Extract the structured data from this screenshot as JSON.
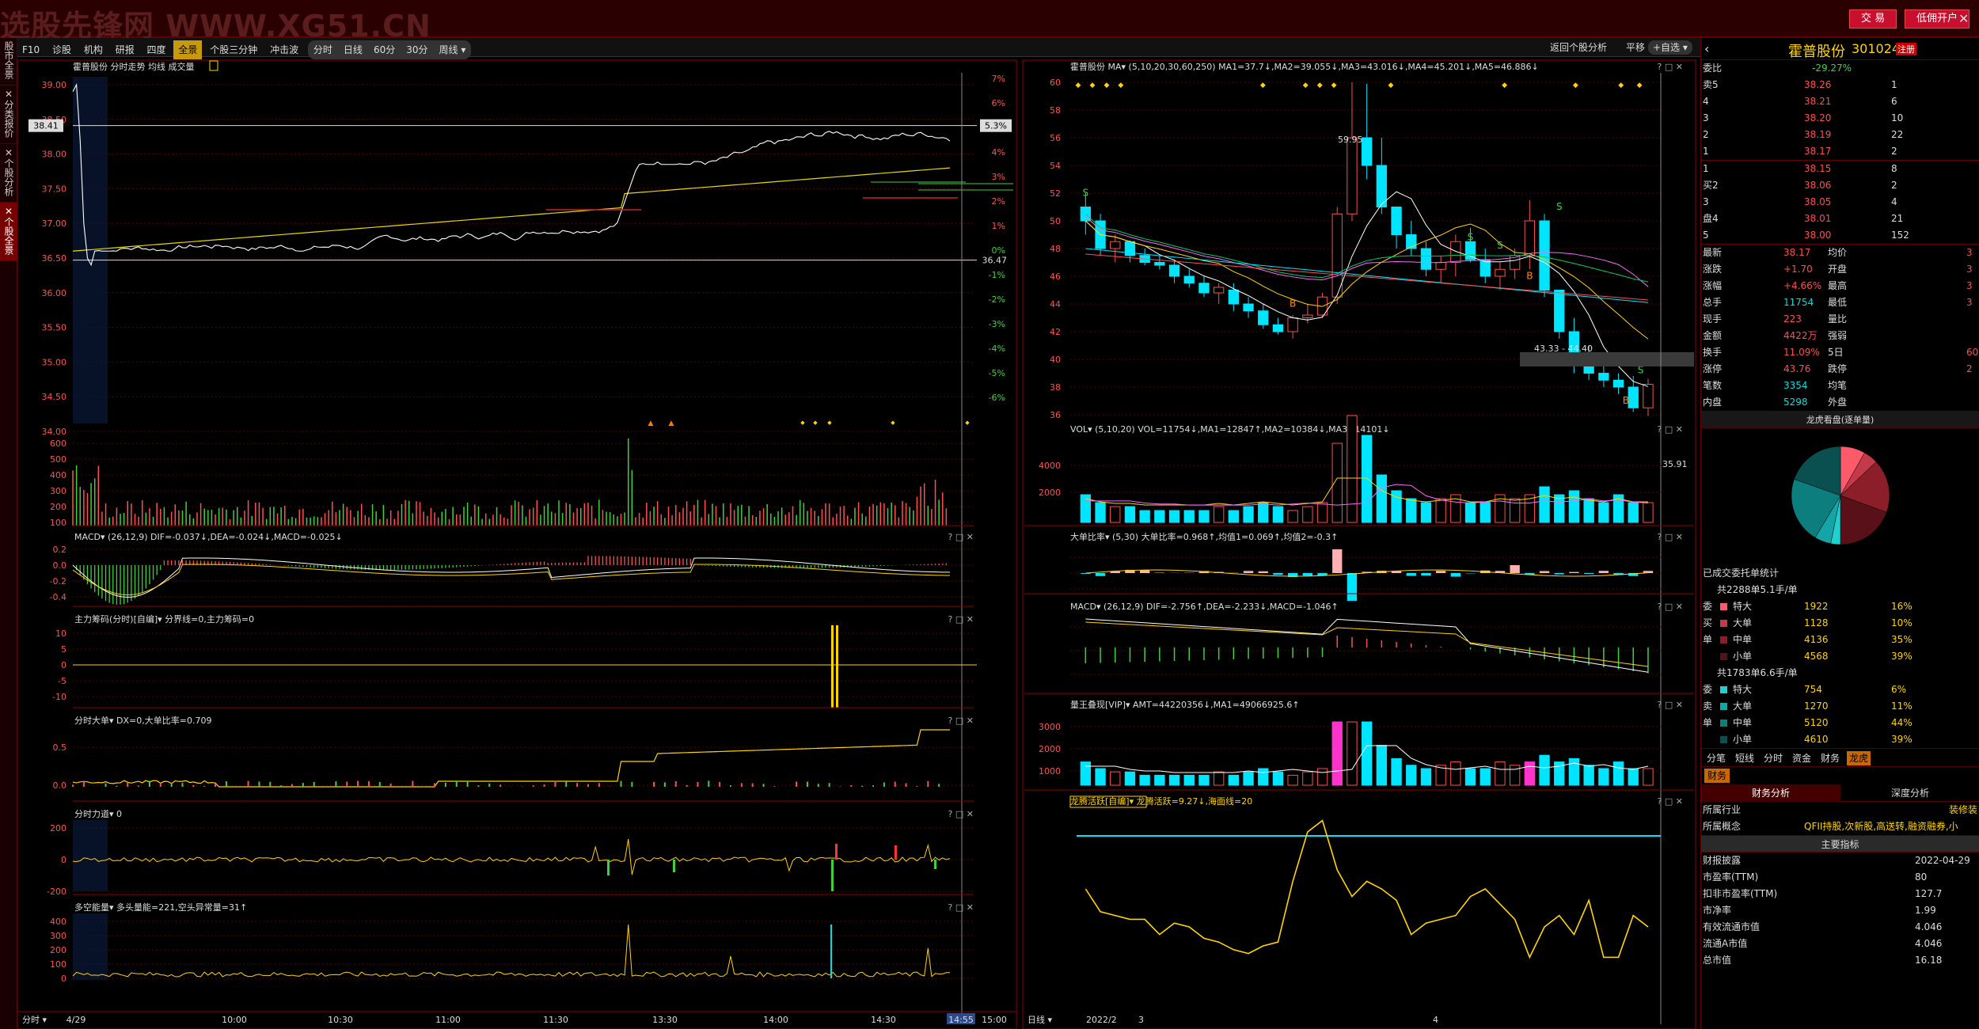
{
  "watermark": "选股先锋网 WWW.XG51.CN",
  "topbar": {
    "trade": "交 易",
    "open_account": "低佣开户"
  },
  "sidebar": {
    "tabs": [
      "股市全景",
      "分类报价",
      "个股分析",
      "个股全景"
    ]
  },
  "toolbar": {
    "items": [
      "F10",
      "诊股",
      "机构",
      "研报",
      "四度"
    ],
    "period_group": [
      "全景"
    ],
    "extra": [
      "个股三分钟",
      "冲击波"
    ],
    "periods": [
      "分时",
      "日线",
      "60分",
      "30分",
      "周线 ▾"
    ],
    "back": "返回个股分析",
    "flat": "平移",
    "self_select": "+自选 ▾"
  },
  "stock": {
    "name": "霍普股份",
    "code": "301024",
    "badge": "注册"
  },
  "left": {
    "price_title": "霍普股份  分时走势 均线 成交量",
    "y_prices": [
      "39.00",
      "38.50",
      "38.00",
      "37.50",
      "37.00",
      "36.50",
      "36.00",
      "35.50",
      "35.00",
      "34.50",
      "34.00"
    ],
    "y_pcts": [
      "7%",
      "6%",
      "5%",
      "4%",
      "3%",
      "2%",
      "1%",
      "0%",
      "-1%",
      "-2%",
      "-3%",
      "-4%",
      "-5%",
      "-6%"
    ],
    "price_tag": "38.41",
    "pct_tag": "5.3%",
    "right_tag": "36.47",
    "vol_ticks": [
      "600",
      "500",
      "400",
      "300",
      "200",
      "100"
    ],
    "macd_title": "MACD▾  (26,12,9)  DIF=-0.037↓,DEA=-0.024↓,MACD=-0.025↓",
    "macd_ticks": [
      "0.2",
      "0.0",
      "-0.2",
      "-0.4"
    ],
    "zlcm_title": "主力筹码(分时)[自编]▾  分界线=0,主力筹码=0",
    "zlcm_ticks": [
      "10",
      "5",
      "0",
      "-5",
      "-10"
    ],
    "fsdd_title": "分时大单▾  DX=0,大单比率=0.709",
    "fsdd_ticks": [
      "0.5",
      "0.0"
    ],
    "fsld_title": "分时力道▾  0",
    "fsld_ticks": [
      "200",
      "0",
      "-200"
    ],
    "dkn_title": "多空能量▾  多头量能=221,空头异常量=31↑",
    "dkn_ticks": [
      "400",
      "300",
      "200",
      "100",
      "0"
    ],
    "times": [
      "4/29",
      "10:00",
      "10:30",
      "11:00",
      "11:30",
      "13:30",
      "14:00",
      "14:30",
      "14:55",
      "15:00"
    ],
    "time_btn": "分时 ▾"
  },
  "middle": {
    "k_title": "霍普股份  MA▾  (5,10,20,30,60,250)  MA1=37.7↓,MA2=39.055↓,MA3=43.016↓,MA4=45.201↓,MA5=46.886↓",
    "k_ticks": [
      "60",
      "58",
      "56",
      "54",
      "52",
      "50",
      "48",
      "46",
      "44",
      "42",
      "40",
      "38",
      "36"
    ],
    "hi_label": "59.95",
    "lo_label": "35.91",
    "range_label": "43.33 - 44.40",
    "vol_title": "VOL▾  (5,10,20)  VOL=11754↓,MA1=12847↑,MA2=10384↓,MA3=14101↓",
    "vol_ticks": [
      "4000",
      "2000"
    ],
    "ddbl_title": "大单比率▾  (5,30)  大单比率=0.968↑,均值1=0.069↑,均值2=-0.3↑",
    "macd_title": "MACD▾  (26,12,9)  DIF=-2.756↑,DEA=-2.233↓,MACD=-1.046↑",
    "lw_title": "量王叠现[VIP]▾  AMT=44220356↓,MA1=49066925.6↑",
    "lw_ticks": [
      "3000",
      "2000",
      "1000"
    ],
    "lt_title": "龙腾活跃[自编]▾  龙腾活跃=9.27↓,海面线=20",
    "dates": [
      "日线 ▾",
      "2022/2",
      "3",
      "4"
    ]
  },
  "right": {
    "webi_label": "委比",
    "webi_val": "-29.27%",
    "asks": [
      {
        "lbl": "卖5",
        "p": "38.26",
        "v": "1"
      },
      {
        "lbl": "4",
        "p": "38.21",
        "v": "6"
      },
      {
        "lbl": "3",
        "p": "38.20",
        "v": "10"
      },
      {
        "lbl": "2",
        "p": "38.19",
        "v": "22"
      },
      {
        "lbl": "1",
        "p": "38.17",
        "v": "2"
      }
    ],
    "bids": [
      {
        "lbl": "1",
        "p": "38.15",
        "v": "8"
      },
      {
        "lbl": "买2",
        "p": "38.06",
        "v": "2"
      },
      {
        "lbl": "3",
        "p": "38.05",
        "v": "4"
      },
      {
        "lbl": "盘4",
        "p": "38.01",
        "v": "21"
      },
      {
        "lbl": "5",
        "p": "38.00",
        "v": "152"
      }
    ],
    "stats": [
      {
        "a": "最新",
        "av": "38.17",
        "b": "均价",
        "bv": "3"
      },
      {
        "a": "涨跌",
        "av": "+1.70",
        "b": "开盘",
        "bv": "3"
      },
      {
        "a": "涨幅",
        "av": "+4.66%",
        "b": "最高",
        "bv": "3"
      },
      {
        "a": "总手",
        "av": "11754",
        "b": "最低",
        "bv": "3"
      },
      {
        "a": "现手",
        "av": "223",
        "b": "量比",
        "bv": ""
      },
      {
        "a": "金额",
        "av": "4422万",
        "b": "强弱",
        "bv": ""
      },
      {
        "a": "换手",
        "av": "11.09%",
        "b": "5日",
        "bv": "60."
      },
      {
        "a": "涨停",
        "av": "43.76",
        "b": "跌停",
        "bv": "2"
      },
      {
        "a": "笔数",
        "av": "3354",
        "b": "均笔",
        "bv": ""
      },
      {
        "a": "内盘",
        "av": "5298",
        "b": "外盘",
        "bv": ""
      }
    ],
    "pie_title": "龙虎看盘(逐单量)",
    "order_title": "已成交委托单统计",
    "buy_sum": "共2288单5.1手/单",
    "buy_rows": [
      {
        "side": "委",
        "n": "特大",
        "v": "1922",
        "p": "16%"
      },
      {
        "side": "买",
        "n": "大单",
        "v": "1128",
        "p": "10%"
      },
      {
        "side": "单",
        "n": "中单",
        "v": "4136",
        "p": "35%"
      },
      {
        "side": "",
        "n": "小单",
        "v": "4568",
        "p": "39%"
      }
    ],
    "sell_sum": "共1783单6.6手/单",
    "sell_rows": [
      {
        "side": "委",
        "n": "特大",
        "v": "754",
        "p": "6%"
      },
      {
        "side": "卖",
        "n": "大单",
        "v": "1270",
        "p": "11%"
      },
      {
        "side": "单",
        "n": "中单",
        "v": "5120",
        "p": "44%"
      },
      {
        "side": "",
        "n": "小单",
        "v": "4610",
        "p": "39%"
      }
    ],
    "tabs": [
      "分笔",
      "短线",
      "分时",
      "资金",
      "财务",
      "龙虎"
    ],
    "fin_tab": "财务",
    "fin_sub": [
      "财务分析",
      "深度分析"
    ],
    "industry_lbl": "所属行业",
    "industry": "装修装",
    "concept_lbl": "所属概念",
    "concept": "QFII持股,次新股,高送转,融资融券,小",
    "main_idx": "主要指标",
    "metrics": [
      {
        "k": "财报披露",
        "v": "2022-04-29"
      },
      {
        "k": "市盈率(TTM)",
        "v": "80"
      },
      {
        "k": "扣非市盈率(TTM)",
        "v": "127.7"
      },
      {
        "k": "市净率",
        "v": "1.99"
      },
      {
        "k": "有效流通市值",
        "v": "4.046"
      },
      {
        "k": "流通A市值",
        "v": "4.046"
      },
      {
        "k": "总市值",
        "v": "16.18"
      }
    ]
  },
  "colors": {
    "up": "#ff4d4d",
    "down": "#3cd23c",
    "cyan": "#00e5ff",
    "yellow": "#ffd400",
    "magenta": "#ff33cc",
    "grid": "#5a0000"
  }
}
